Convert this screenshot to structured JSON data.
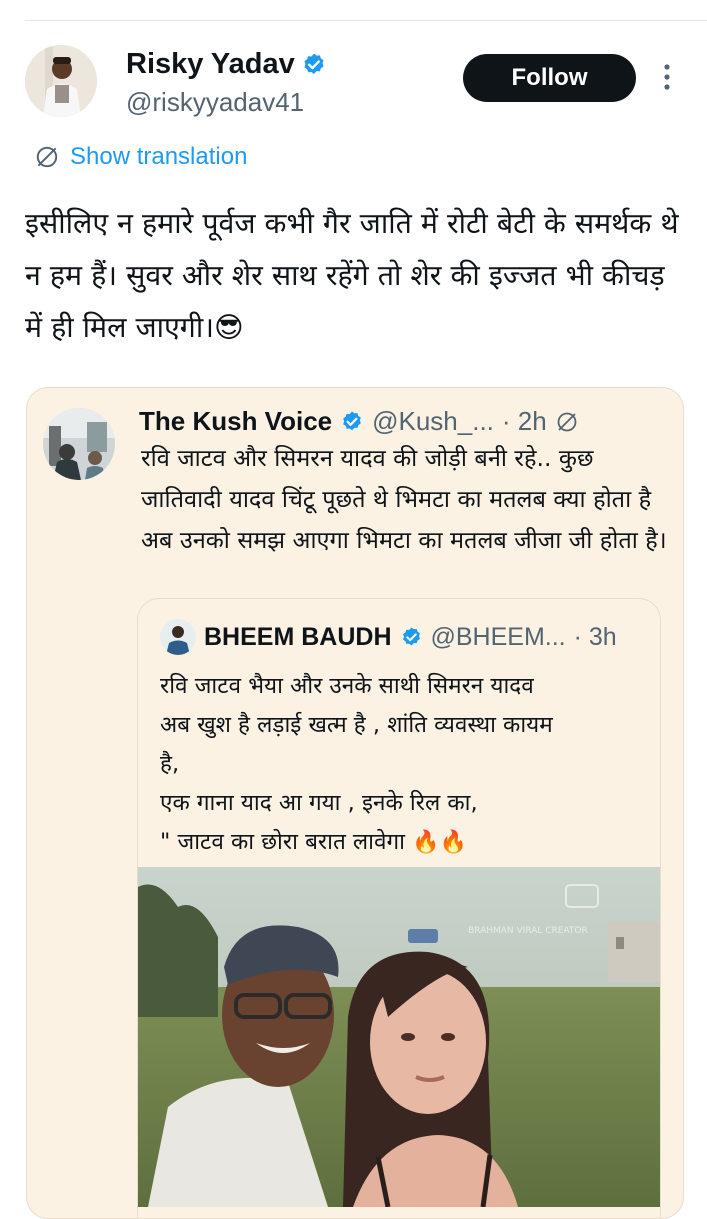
{
  "tweet": {
    "author_name": "Risky Yadav",
    "author_handle": "@riskyyadav41",
    "follow_label": "Follow",
    "show_translation_label": "Show translation",
    "text": "इसीलिए न हमारे पूर्वज कभी गैर जाति में रोटी बेटी के समर्थक थे न हम हैं। सुवर और शेर साथ रहेंगे तो शेर की इज्जत भी कीचड़ में ही मिल जाएगी।😎"
  },
  "quote": {
    "author_name": "The Kush Voice",
    "author_handle": "@Kush_...",
    "time": "· 2h",
    "text": "रवि जाटव और सिमरन यादव की जोड़ी बनी रहे.. कुछ जातिवादी यादव चिंटू पूछते थे भिमटा का मतलब क्या होता है अब उनको समझ आएगा भिमटा का मतलब जीजा जी होता है।"
  },
  "inner_quote": {
    "author_name": "BHEEM BAUDH",
    "author_handle": "@BHEEM...",
    "time": "· 3h",
    "lines": [
      "रवि जाटव भैया और उनके साथी सिमरन यादव",
      "अब खुश है लड़ाई खत्म है , शांति व्यवस्था कायम",
      "है,",
      "एक गाना याद आ गया , इनके रिल का,"
    ],
    "last_line": "\" जाटव का छोरा बरात लावेगा",
    "flames": "🔥🔥"
  },
  "colors": {
    "follow_bg": "#0f1419",
    "link_blue": "#1d9bf0",
    "verified_blue": "#1d9bf0",
    "quote_bg": "#fbf2e4",
    "secondary_text": "#536471"
  },
  "icons": [
    "verified-badge-icon",
    "more-options-icon",
    "translate-icon",
    "translate-small-icon"
  ]
}
